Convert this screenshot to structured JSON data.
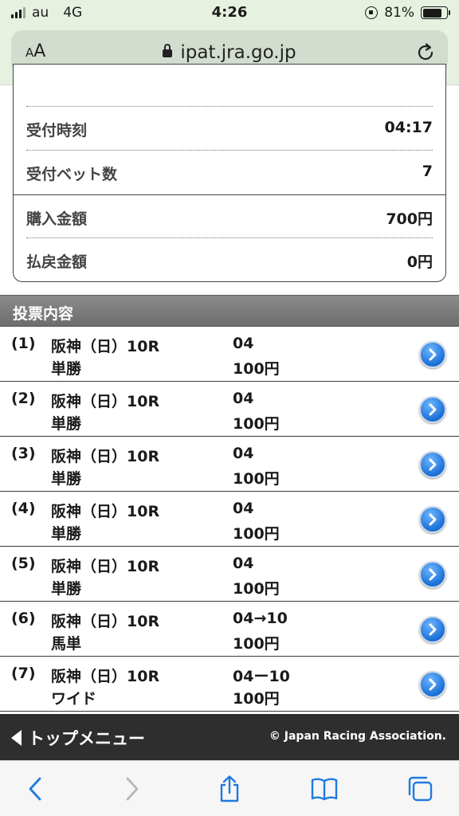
{
  "status_bar": {
    "carrier": "au",
    "network": "4G",
    "time": "4:26",
    "battery": "81%",
    "battery_level": 0.81
  },
  "browser": {
    "text_size_label_small": "A",
    "text_size_label_large": "A",
    "url": "ipat.jra.go.jp"
  },
  "summary": {
    "rows": [
      {
        "label": "受付時刻",
        "value": "04:17"
      },
      {
        "label": "受付ベット数",
        "value": "7"
      },
      {
        "label": "購入金額",
        "value": "700円"
      },
      {
        "label": "払戻金額",
        "value": "0円"
      }
    ]
  },
  "section": {
    "title": "投票内容"
  },
  "bets": [
    {
      "num": "(1)",
      "race": "阪神（日）10R",
      "type": "単勝",
      "selection": "04",
      "amount": "100円"
    },
    {
      "num": "(2)",
      "race": "阪神（日）10R",
      "type": "単勝",
      "selection": "04",
      "amount": "100円"
    },
    {
      "num": "(3)",
      "race": "阪神（日）10R",
      "type": "単勝",
      "selection": "04",
      "amount": "100円"
    },
    {
      "num": "(4)",
      "race": "阪神（日）10R",
      "type": "単勝",
      "selection": "04",
      "amount": "100円"
    },
    {
      "num": "(5)",
      "race": "阪神（日）10R",
      "type": "単勝",
      "selection": "04",
      "amount": "100円"
    },
    {
      "num": "(6)",
      "race": "阪神（日）10R",
      "type": "馬単",
      "selection": "04→10",
      "amount": "100円"
    },
    {
      "num": "(7)",
      "race": "阪神（日）10R",
      "type": "ワイド",
      "selection": "04ー10",
      "amount": "100円"
    }
  ],
  "footer": {
    "top_menu": "トップメニュー",
    "copyright": "© Japan Racing Association."
  },
  "colors": {
    "browser_chrome": "#e6f1e0",
    "section_header": "#7a7a7a",
    "footer": "#2e2e2e",
    "action_blue": "#1a6fd6",
    "toolbar_icon": "#1f7ae0"
  }
}
